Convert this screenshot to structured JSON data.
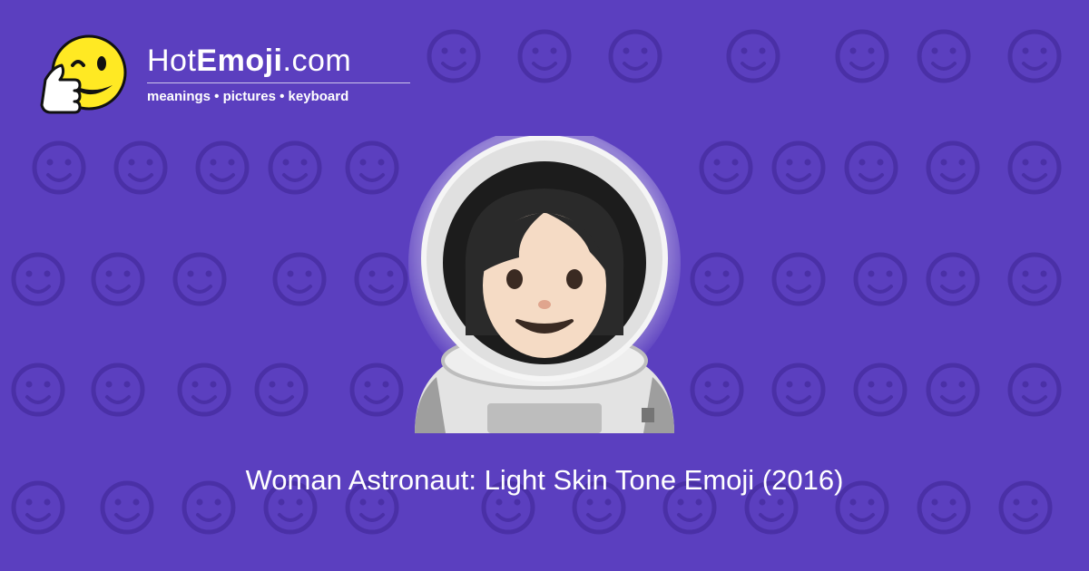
{
  "brand": {
    "name_prefix": "Hot",
    "name_bold": "Emoji",
    "name_suffix": ".com",
    "tagline": "meanings • pictures • keyboard",
    "logo_icon": "winking-thumbs-up-smiley"
  },
  "emoji": {
    "icon": "woman-astronaut-light-skin-tone",
    "caption": "Woman Astronaut: Light Skin Tone Emoji (2016)"
  },
  "background": {
    "color": "#5b3fbf",
    "pattern_color": "#4a30a6",
    "pattern_icons": [
      "smiling-face-icon",
      "beaming-face-icon",
      "kissing-face-icon",
      "winking-face-icon",
      "two-hearts-icon",
      "smiley-icon",
      "persevering-face-icon",
      "ok-hand-icon",
      "relieved-face-icon",
      "eyes-icon",
      "smirking-face-icon",
      "relieved-face-icon",
      "grimacing-face-icon",
      "recycle-icon",
      "raising-hands-icon",
      "musical-notes-icon",
      "sleeping-face-icon",
      "sad-face-icon",
      "grinning-face-icon",
      "sparkles-icon",
      "grinning-face-icon",
      "striped-heart-icon",
      "broken-heart-icon",
      "confused-face-icon",
      "striped-heart-icon",
      "tongue-wink-face-icon",
      "frowning-face-icon",
      "heart-arrow-icon",
      "weary-face-icon",
      "smiling-hearts-face-icon",
      "heart-icon",
      "monkey-icon",
      "screaming-face-icon",
      "smiling-devil-icon",
      "angry-face-icon",
      "left-arrow-icon",
      "fire-icon",
      "party-popper-icon",
      "squinting-tongue-face-icon",
      "rose-icon",
      "sun-icon",
      "flexed-biceps-icon",
      "striped-heart-icon",
      "check-mark-icon",
      "squinting-face-icon",
      "smiley-icon",
      "smiling-cat-icon",
      "waving-hand-icon",
      "grinning-face-icon",
      "camera-icon",
      "winking-face-icon",
      "beaming-face-icon",
      "heart-icon",
      "kissing-face-icon"
    ]
  }
}
